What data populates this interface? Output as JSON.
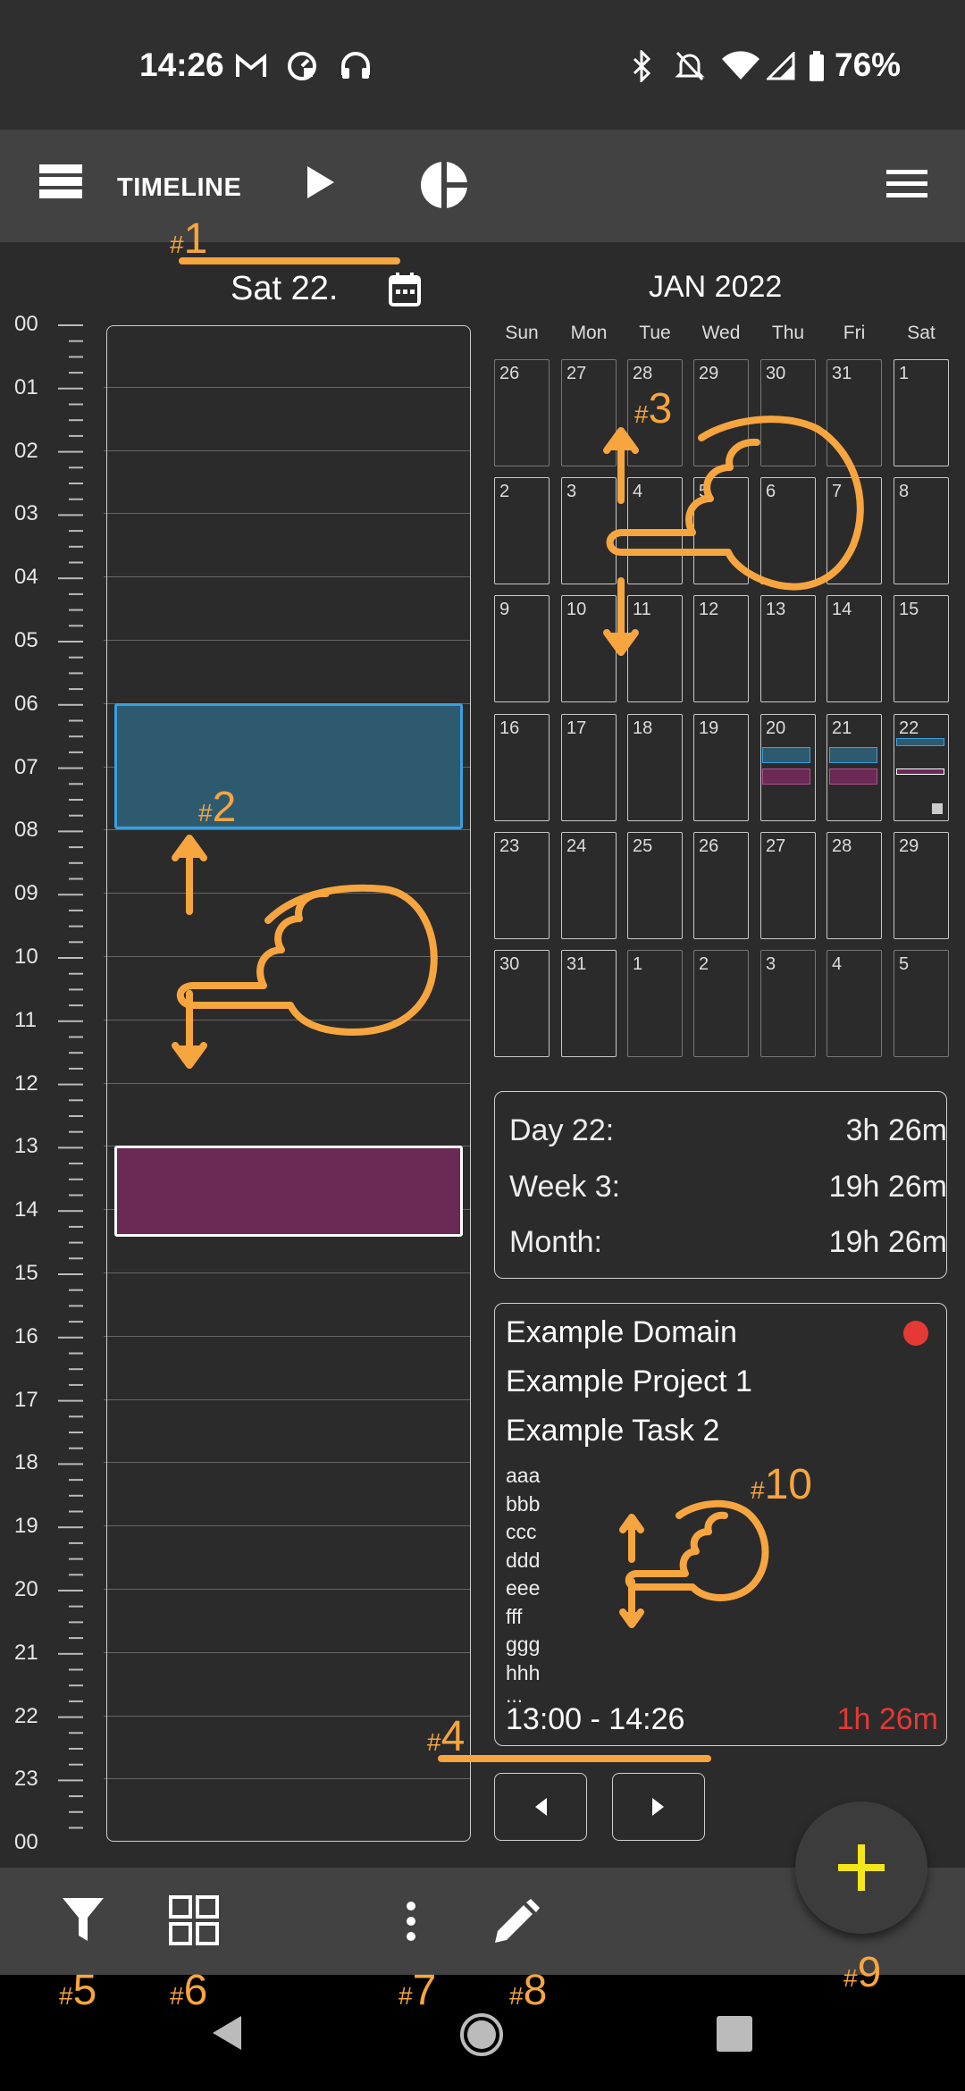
{
  "status_bar": {
    "time": "14:26",
    "battery": "76%",
    "icons": [
      "gmail-icon",
      "data-saver-icon",
      "headset-icon",
      "bluetooth-icon",
      "silent-icon",
      "wifi-icon",
      "signal-icon",
      "battery-icon"
    ]
  },
  "toolbar": {
    "view_label": "TIMELINE",
    "icons": [
      "list-view-icon",
      "play-icon",
      "pie-chart-icon",
      "menu-icon"
    ]
  },
  "timeline": {
    "date_label": "Sat 22.",
    "hours": [
      "00",
      "01",
      "02",
      "03",
      "04",
      "05",
      "06",
      "07",
      "08",
      "09",
      "10",
      "11",
      "12",
      "13",
      "14",
      "15",
      "16",
      "17",
      "18",
      "19",
      "20",
      "21",
      "22",
      "23",
      "00"
    ],
    "entries": [
      {
        "start_hour": 6.0,
        "end_hour": 8.0,
        "color": "#2e5a70",
        "border": "#3aa0e0"
      },
      {
        "start_hour": 13.0,
        "end_hour": 14.43,
        "color": "#6b2a55",
        "border": "#ffffff"
      }
    ]
  },
  "calendar": {
    "month_label": "JAN 2022",
    "weekdays": [
      "Sun",
      "Mon",
      "Tue",
      "Wed",
      "Thu",
      "Fri",
      "Sat"
    ],
    "weeks": [
      [
        "26",
        "27",
        "28",
        "29",
        "30",
        "31",
        "1"
      ],
      [
        "2",
        "3",
        "4",
        "5",
        "6",
        "7",
        "8"
      ],
      [
        "9",
        "10",
        "11",
        "12",
        "13",
        "14",
        "15"
      ],
      [
        "16",
        "17",
        "18",
        "19",
        "20",
        "21",
        "22"
      ],
      [
        "23",
        "24",
        "25",
        "26",
        "27",
        "28",
        "29"
      ],
      [
        "30",
        "31",
        "1",
        "2",
        "3",
        "4",
        "5"
      ]
    ]
  },
  "stats": {
    "day_label": "Day 22:",
    "day_value": "3h 26m",
    "week_label": "Week 3:",
    "week_value": "19h 26m",
    "month_label": "Month:",
    "month_value": "19h 26m"
  },
  "detail": {
    "domain": "Example Domain",
    "project": "Example Project 1",
    "task": "Example Task 2",
    "notes": [
      "aaa",
      "bbb",
      "ccc",
      "ddd",
      "eee",
      "fff",
      "ggg",
      "hhh",
      "..."
    ],
    "time_range": "13:00 - 14:26",
    "duration": "1h 26m",
    "status_color": "#e53935",
    "duration_color": "#e53935"
  },
  "bottom_bar": {
    "icons": [
      "filter-icon",
      "grid-icon",
      "more-vertical-icon",
      "edit-icon",
      "add-icon"
    ],
    "fab_color": "#f5e51b"
  },
  "annotations": {
    "hash": "#",
    "n1": "1",
    "n2": "2",
    "n3": "3",
    "n4": "4",
    "n5": "5",
    "n6": "6",
    "n7": "7",
    "n8": "8",
    "n9": "9",
    "n10": "10"
  },
  "colors": {
    "accent": "#f7a53f",
    "background": "#2b2b2b",
    "bar": "#424242"
  }
}
